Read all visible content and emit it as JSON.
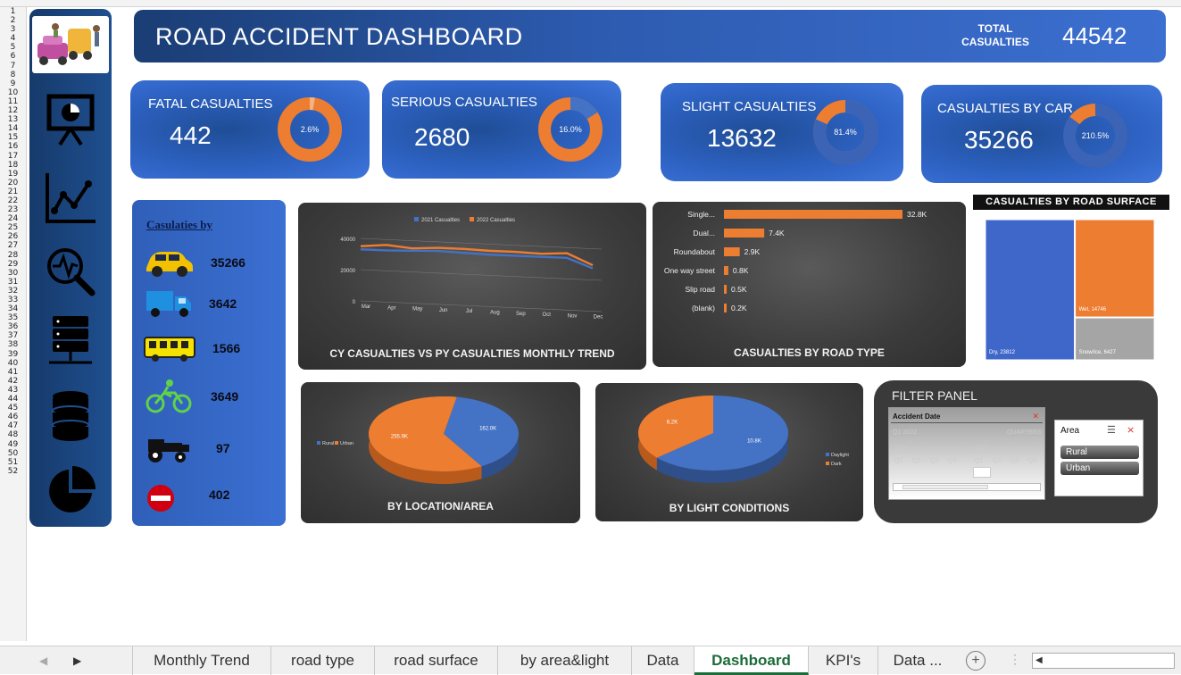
{
  "header": {
    "title": "ROAD ACCIDENT DASHBOARD",
    "total_label": "TOTAL CASUALTIES",
    "total_value": "44542"
  },
  "kpis": [
    {
      "label": "FATAL CASUALTIES",
      "value": "442",
      "pct_label": "2.6%",
      "pct": 0.026
    },
    {
      "label": "SERIOUS CASUALTIES",
      "value": "2680",
      "pct_label": "16.0%",
      "pct": 0.16
    },
    {
      "label": "SLIGHT CASUALTIES",
      "value": "13632",
      "pct_label": "81.4%",
      "pct": 0.814
    },
    {
      "label": "CASUALTIES BY CAR",
      "value": "35266",
      "pct_label": "210.5%",
      "pct": 1.0
    }
  ],
  "vehicles": {
    "title": "Casulaties by",
    "items": [
      {
        "icon": "car-icon",
        "value": "35266"
      },
      {
        "icon": "truck-icon",
        "value": "3642"
      },
      {
        "icon": "bus-icon",
        "value": "1566"
      },
      {
        "icon": "bicycle-icon",
        "value": "3649"
      },
      {
        "icon": "tractor-icon",
        "value": "97"
      },
      {
        "icon": "no-entry-icon",
        "value": "402"
      }
    ]
  },
  "charts": {
    "trend_title": "CY CASUALTIES VS PY CASUALTIES MONTHLY TREND",
    "roadtype_title": "CASUALTIES BY ROAD TYPE",
    "surface_title": "CASUALTIES BY ROAD SURFACE",
    "location_title": "BY LOCATION/AREA",
    "light_title": "BY LIGHT CONDITIONS"
  },
  "chart_data": [
    {
      "type": "line",
      "title": "CY CASUALTIES VS PY CASUALTIES MONTHLY TREND",
      "categories": [
        "Mar",
        "Apr",
        "May",
        "Jun",
        "Jul",
        "Aug",
        "Sep",
        "Oct",
        "Nov",
        "Dec"
      ],
      "series": [
        {
          "name": "2021 Casualties",
          "values": [
            33000,
            33000,
            33500,
            34000,
            33500,
            33000,
            33000,
            33000,
            33000,
            27000
          ]
        },
        {
          "name": "2022 Casualties",
          "values": [
            35000,
            36500,
            35000,
            36000,
            36000,
            35500,
            35500,
            35000,
            36000,
            29000
          ]
        }
      ],
      "yticks": [
        "0",
        "20000",
        "40000"
      ],
      "ylim": [
        0,
        40000
      ],
      "legend": "top"
    },
    {
      "type": "bar",
      "title": "CASUALTIES BY ROAD TYPE",
      "categories": [
        "Single...",
        "Dual...",
        "Roundabout",
        "One way street",
        "Slip road",
        "(blank)"
      ],
      "values": [
        32800,
        7400,
        2900,
        800,
        500,
        200
      ],
      "value_labels": [
        "32.8K",
        "7.4K",
        "2.9K",
        "0.8K",
        "0.5K",
        "0.2K"
      ]
    },
    {
      "type": "treemap",
      "title": "CASUALTIES BY ROAD SURFACE",
      "items": [
        {
          "label": "Dry, 23812",
          "value": 23812,
          "color": "#3f67c9"
        },
        {
          "label": "Wet, 14746",
          "value": 14746,
          "color": "#ed7d31"
        },
        {
          "label": "Snow/Ice, 6427",
          "value": 6427,
          "color": "#a5a5a5"
        }
      ]
    },
    {
      "type": "pie",
      "title": "BY LOCATION/AREA",
      "series": [
        {
          "name": "Rural",
          "value": 162000,
          "label": "162.0K",
          "color": "#4472c4"
        },
        {
          "name": "Urban",
          "value": 255900,
          "label": "255.9K",
          "color": "#ed7d31"
        }
      ],
      "legend": "left"
    },
    {
      "type": "pie",
      "title": "BY LIGHT CONDITIONS",
      "series": [
        {
          "name": "Daylight",
          "value": 10800,
          "label": "10.8K",
          "color": "#4472c4"
        },
        {
          "name": "Dark",
          "value": 6200,
          "label": "6.2K",
          "color": "#ed7d31"
        }
      ],
      "legend": "right"
    }
  ],
  "filter": {
    "title": "FILTER PANEL",
    "date_label": "Accident Date",
    "date_selection": "Q1 2022",
    "date_level": "QUARTERS",
    "years": [
      "2021",
      "2022"
    ],
    "quarters": [
      "Q1",
      "Q2",
      "Q3",
      "Q4",
      "Q1",
      "Q2",
      "Q3",
      "Q4"
    ],
    "area_label": "Area",
    "area_options": [
      "Rural",
      "Urban"
    ]
  },
  "tabs": [
    "Monthly Trend",
    "road type",
    "road surface",
    "by area&light",
    "Data",
    "Dashboard",
    "KPI's",
    "Data ..."
  ],
  "active_tab": "Dashboard",
  "colors": {
    "orange": "#ed7d31",
    "blue": "#4472c4",
    "navy": "#163a6b",
    "tab_active": "#1d6b3b"
  }
}
